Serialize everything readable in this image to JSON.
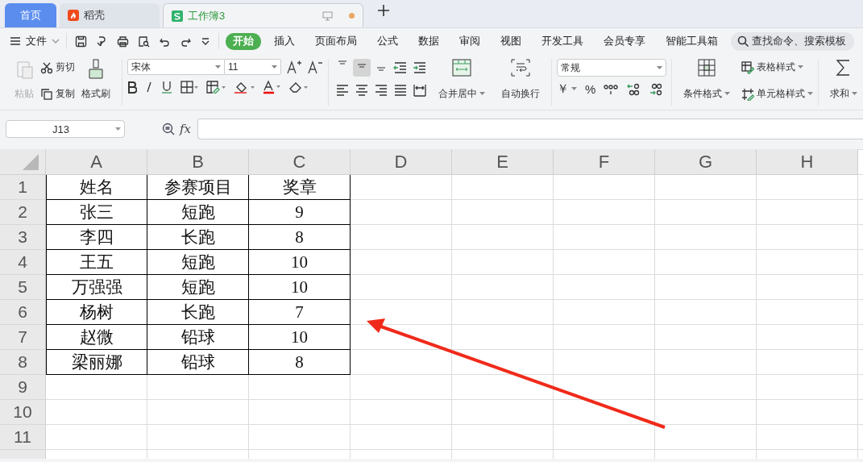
{
  "tabs": [
    {
      "label": "首页",
      "selected": false
    },
    {
      "label": "稻壳",
      "selected": false
    },
    {
      "label": "工作簿3",
      "selected": true
    }
  ],
  "menu": {
    "file": "文件",
    "ribbon_tabs": [
      {
        "label": "开始",
        "selected": true
      },
      {
        "label": "插入",
        "selected": false
      },
      {
        "label": "页面布局",
        "selected": false
      },
      {
        "label": "公式",
        "selected": false
      },
      {
        "label": "数据",
        "selected": false
      },
      {
        "label": "审阅",
        "selected": false
      },
      {
        "label": "视图",
        "selected": false
      },
      {
        "label": "开发工具",
        "selected": false
      },
      {
        "label": "会员专享",
        "selected": false
      },
      {
        "label": "智能工具箱",
        "selected": false
      }
    ],
    "search": {
      "placeholder": "查找命令、搜索模板"
    }
  },
  "ribbon": {
    "paste": {
      "label": "粘贴",
      "disabled": true
    },
    "cut": "剪切",
    "copy": "复制",
    "format_painter": "格式刷",
    "font_name": "宋体",
    "font_size": "11",
    "vertical_align": [
      {
        "selected": false
      },
      {
        "selected": true
      },
      {
        "selected": false
      }
    ],
    "merge": "合并居中",
    "wrap": "自动换行",
    "number_format": "常规",
    "currency": "￥",
    "percent": "%",
    "table_style": "表格样式",
    "cell_style": "单元格样式",
    "conditional_format": "条件格式",
    "sum": "求和"
  },
  "formula_bar": {
    "name_box": "J13",
    "fx": "fx"
  },
  "sheet": {
    "columns": [
      "A",
      "B",
      "C",
      "D",
      "E",
      "F",
      "G",
      "H"
    ],
    "row_numbers": [
      "1",
      "2",
      "3",
      "4",
      "5",
      "6",
      "7",
      "8",
      "9",
      "10",
      "11"
    ],
    "rows": [
      [
        "姓名",
        "参赛项目",
        "奖章"
      ],
      [
        "张三",
        "短跑",
        "9"
      ],
      [
        "李四",
        "长跑",
        "8"
      ],
      [
        "王五",
        "短跑",
        "10"
      ],
      [
        "万强强",
        "短跑",
        "10"
      ],
      [
        "杨树",
        "长跑",
        "7"
      ],
      [
        "赵微",
        "铅球",
        "10"
      ],
      [
        "梁丽娜",
        "铅球",
        "8"
      ]
    ]
  }
}
